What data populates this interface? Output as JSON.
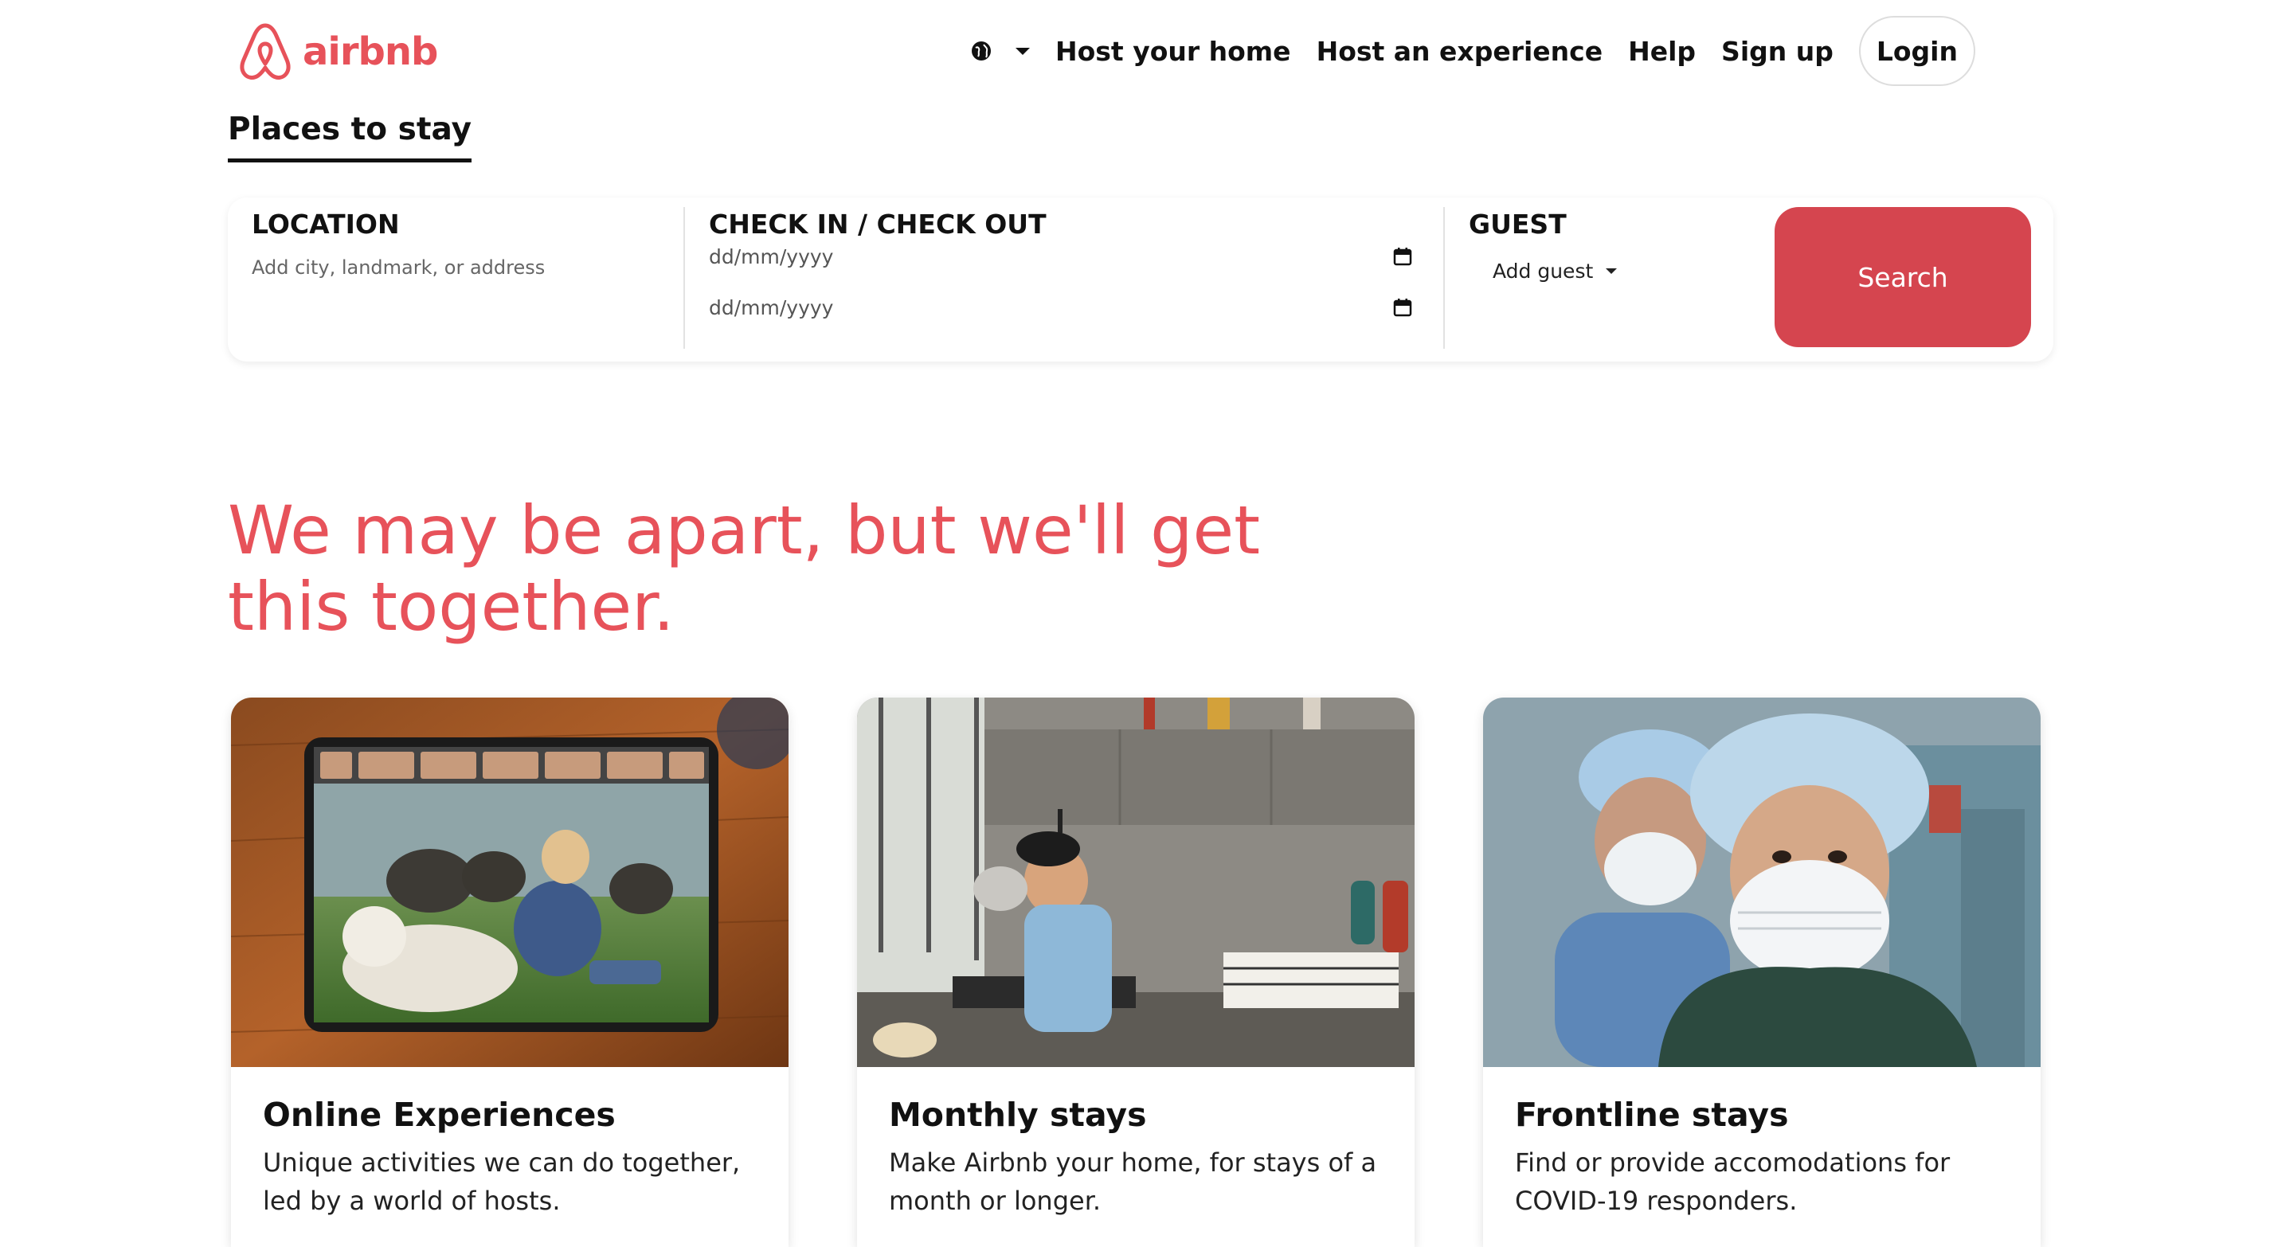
{
  "brand": {
    "name": "airbnb",
    "color": "#e7525a"
  },
  "nav": {
    "globe_icon": "globe-icon",
    "host_home": "Host your home",
    "host_experience": "Host an experience",
    "help": "Help",
    "sign_up": "Sign up",
    "login": "Login"
  },
  "tab": {
    "label": "Places to stay"
  },
  "search": {
    "location_label": "LOCATION",
    "location_placeholder": "Add city, landmark, or address",
    "dates_label": "CHECK IN / CHECK OUT",
    "check_in_placeholder": "dd/mm/yyyy",
    "check_out_placeholder": "dd/mm/yyyy",
    "guest_label": "GUEST",
    "guest_select": "Add guest",
    "button": "Search",
    "button_color": "#d5454f"
  },
  "hero": {
    "headline": "We may be apart, but we'll get this together."
  },
  "cards": [
    {
      "title": "Online Experiences",
      "description": "Unique activities we can do together, led by a world of hosts."
    },
    {
      "title": "Monthly stays",
      "description": "Make Airbnb your home, for stays of a month or longer."
    },
    {
      "title": "Frontline stays",
      "description": "Find or provide accomodations for COVID-19 responders."
    }
  ]
}
